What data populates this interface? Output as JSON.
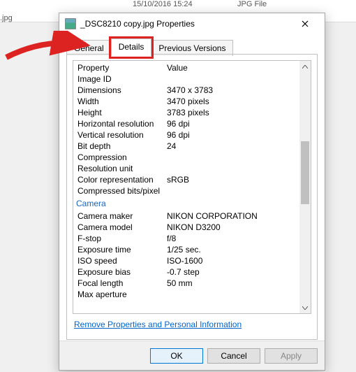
{
  "background": {
    "filename": ".jpg",
    "date": "15/10/2016 15:24",
    "type": "JPG File"
  },
  "dialog": {
    "title": "_DSC8210 copy.jpg Properties",
    "tabs": {
      "general": "General",
      "details": "Details",
      "previous": "Previous Versions"
    },
    "columns": {
      "property": "Property",
      "value": "Value"
    },
    "rows": [
      {
        "name": "Image ID",
        "value": ""
      },
      {
        "name": "Dimensions",
        "value": "3470 x 3783"
      },
      {
        "name": "Width",
        "value": "3470 pixels"
      },
      {
        "name": "Height",
        "value": "3783 pixels"
      },
      {
        "name": "Horizontal resolution",
        "value": "96 dpi"
      },
      {
        "name": "Vertical resolution",
        "value": "96 dpi"
      },
      {
        "name": "Bit depth",
        "value": "24"
      },
      {
        "name": "Compression",
        "value": ""
      },
      {
        "name": "Resolution unit",
        "value": ""
      },
      {
        "name": "Color representation",
        "value": "sRGB"
      },
      {
        "name": "Compressed bits/pixel",
        "value": ""
      }
    ],
    "section_camera": "Camera",
    "camera_rows": [
      {
        "name": "Camera maker",
        "value": "NIKON CORPORATION"
      },
      {
        "name": "Camera model",
        "value": "NIKON D3200"
      },
      {
        "name": "F-stop",
        "value": "f/8"
      },
      {
        "name": "Exposure time",
        "value": "1/25 sec."
      },
      {
        "name": "ISO speed",
        "value": "ISO-1600"
      },
      {
        "name": "Exposure bias",
        "value": "-0.7 step"
      },
      {
        "name": "Focal length",
        "value": "50 mm"
      },
      {
        "name": "Max aperture",
        "value": ""
      }
    ],
    "link": "Remove Properties and Personal Information",
    "buttons": {
      "ok": "OK",
      "cancel": "Cancel",
      "apply": "Apply"
    }
  }
}
